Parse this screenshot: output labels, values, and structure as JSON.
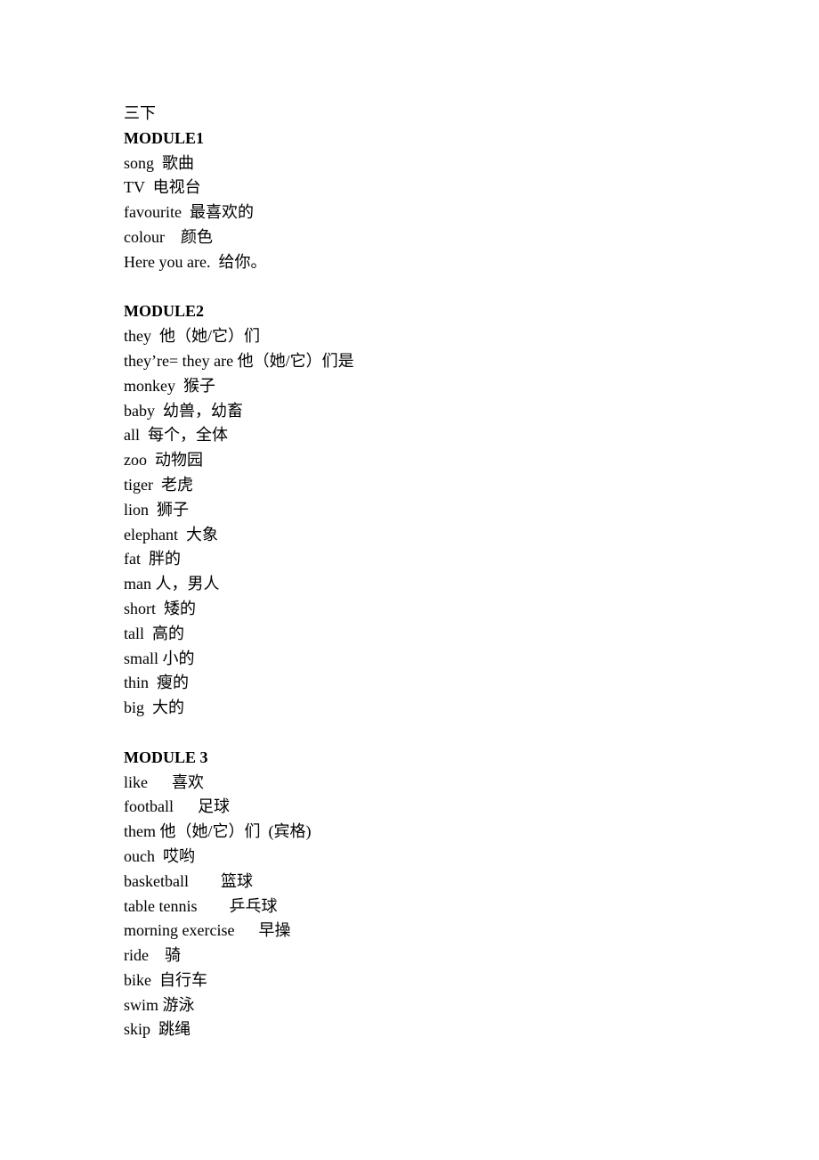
{
  "document": {
    "title": "三下",
    "modules": [
      {
        "heading": "MODULE1",
        "entries": [
          "song  歌曲",
          "TV  电视台",
          "favourite  最喜欢的",
          "colour    颜色",
          "Here you are.  给你。"
        ]
      },
      {
        "heading": "MODULE2",
        "entries": [
          "they  他（她/它）们",
          "they’re= they are 他（她/它）们是",
          "monkey  猴子",
          "baby  幼兽，幼畜",
          "all  每个，全体",
          "zoo  动物园",
          "tiger  老虎",
          "lion  狮子",
          "elephant  大象",
          "fat  胖的",
          "man 人，男人",
          "short  矮的",
          "tall  高的",
          "small 小的",
          "thin  瘦的",
          "big  大的"
        ]
      },
      {
        "heading": "MODULE 3",
        "entries": [
          "like      喜欢",
          "football      足球",
          "them 他（她/它）们  (宾格)",
          "ouch  哎哟",
          "basketball        篮球",
          "table tennis        乒乓球",
          "morning exercise      早操",
          "ride    骑",
          "bike  自行车",
          "swim 游泳",
          "skip  跳绳"
        ]
      }
    ]
  }
}
